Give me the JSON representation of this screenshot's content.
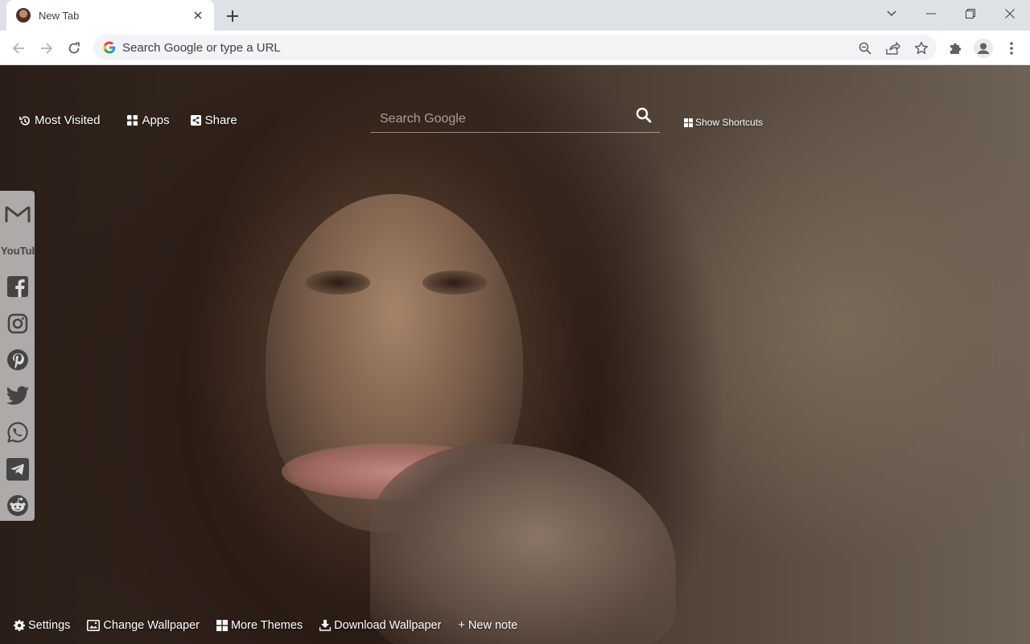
{
  "browser": {
    "tab": {
      "title": "New Tab"
    },
    "omnibox": {
      "placeholder": "Search Google or type a URL"
    }
  },
  "ntp": {
    "top_nav": {
      "most_visited": "Most Visited",
      "apps": "Apps",
      "share": "Share"
    },
    "search": {
      "placeholder": "Search Google"
    },
    "show_shortcuts": "Show Shortcuts",
    "social_icons": [
      "gmail-icon",
      "youtube-icon",
      "facebook-icon",
      "instagram-icon",
      "pinterest-icon",
      "twitter-icon",
      "whatsapp-icon",
      "telegram-icon",
      "reddit-icon"
    ],
    "youtube_logo": "YouTube",
    "bottom_bar": {
      "settings": "Settings",
      "change_wallpaper": "Change Wallpaper",
      "more_themes": "More Themes",
      "download_wallpaper": "Download Wallpaper",
      "new_note": "+ New note"
    }
  },
  "colors": {
    "chrome_bg": "#dee1e6",
    "toolbar_bg": "#ffffff",
    "omnibox_bg": "#f1f3f4",
    "icon_gray": "#5f6368",
    "social_panel": "#e1e1e1"
  }
}
